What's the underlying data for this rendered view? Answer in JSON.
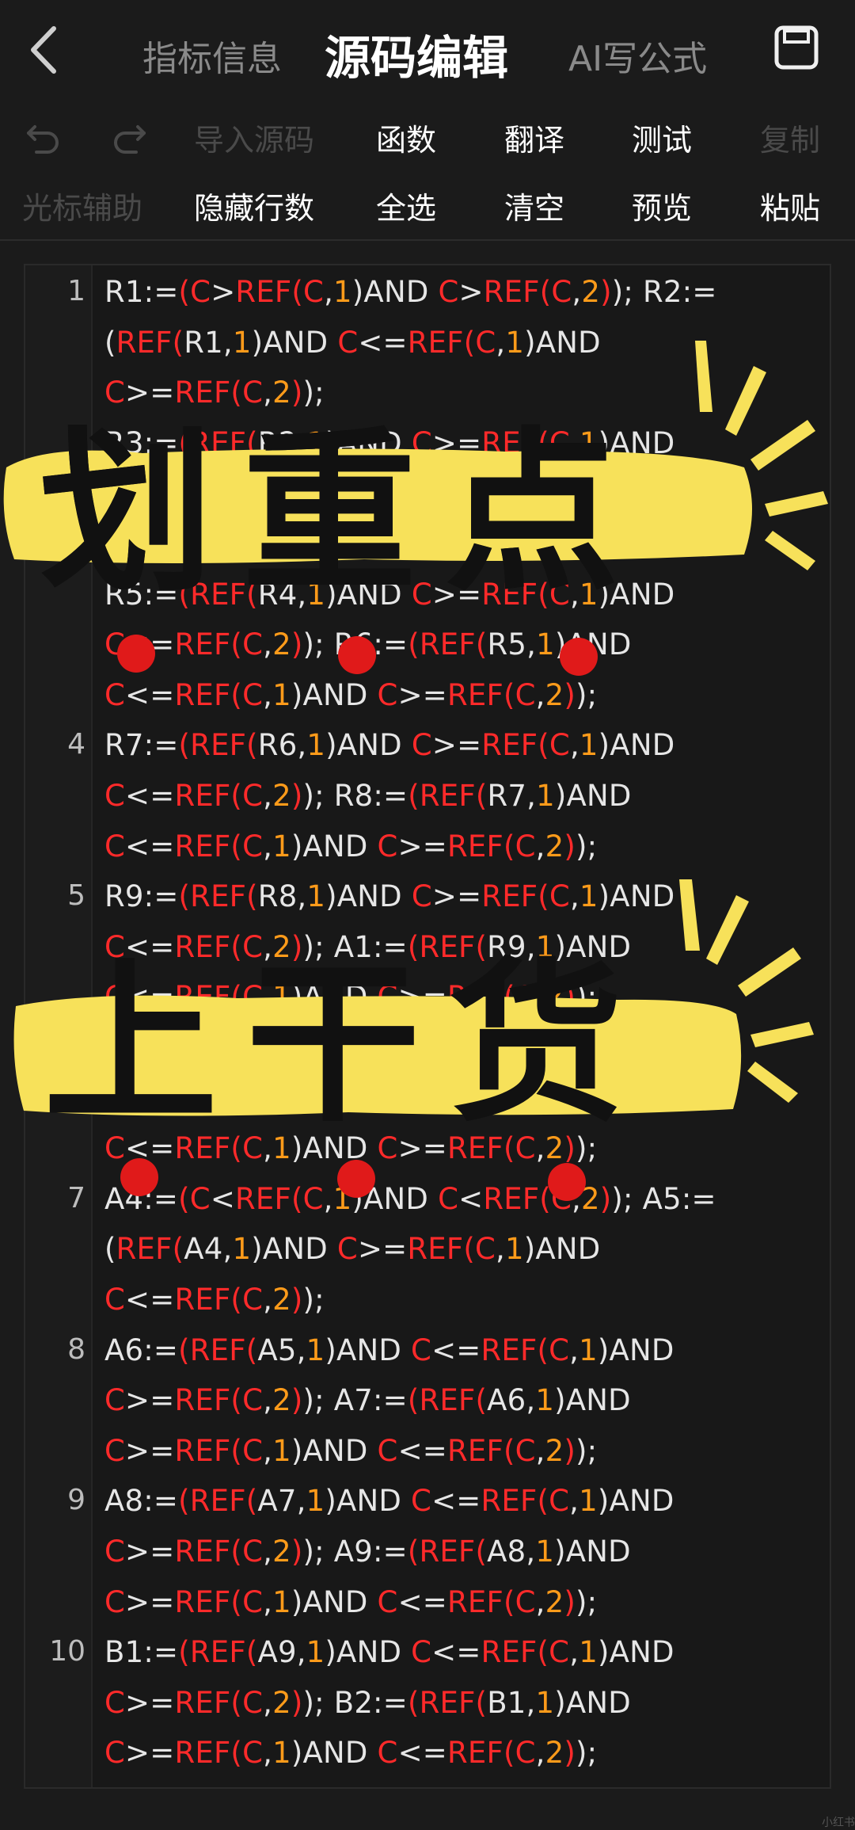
{
  "header": {
    "back_icon": "chevron-left-icon",
    "tabs": [
      {
        "label": "指标信息",
        "active": false
      },
      {
        "label": "源码编辑",
        "active": true
      },
      {
        "label": "AI写公式",
        "active": false
      }
    ],
    "save_icon": "save-icon"
  },
  "toolbar": {
    "row1": [
      {
        "label": "导入源码",
        "enabled": false
      },
      {
        "label": "函数",
        "enabled": true
      },
      {
        "label": "翻译",
        "enabled": true
      },
      {
        "label": "测试",
        "enabled": true
      },
      {
        "label": "复制",
        "enabled": false
      }
    ],
    "row2": [
      {
        "label": "光标辅助",
        "enabled": false
      },
      {
        "label": "隐藏行数",
        "enabled": true
      },
      {
        "label": "全选",
        "enabled": true
      },
      {
        "label": "清空",
        "enabled": true
      },
      {
        "label": "预览",
        "enabled": true
      },
      {
        "label": "粘贴",
        "enabled": true
      }
    ]
  },
  "editor": {
    "line_numbers": [
      "1",
      "",
      "",
      "",
      "",
      "",
      "4",
      "",
      "",
      "5",
      "",
      "",
      "",
      "",
      "",
      "7",
      "",
      "",
      "8",
      "",
      "",
      "9",
      "",
      "",
      "10",
      "",
      ""
    ],
    "visible_line_numbers": [
      {
        "n": "1",
        "row": 0
      },
      {
        "n": "4",
        "row": 9
      },
      {
        "n": "5",
        "row": 12
      },
      {
        "n": "7",
        "row": 18
      },
      {
        "n": "8",
        "row": 21
      },
      {
        "n": "9",
        "row": 24
      },
      {
        "n": "10",
        "row": 27
      }
    ],
    "code_rows": [
      "R1:=(C>REF(C,1)AND C>REF(C,2)); R2:=",
      "(REF(R1,1)AND C<=REF(C,1)AND",
      "C>=REF(C,2));",
      "R3:=(REF(R2,1)AND C>=REF(C,1)AND",
      "",
      "",
      "R5:=(REF(R4,1)AND C>=REF(C,1)AND",
      "C<=REF(C,2)); R6:=(REF(R5,1)AND",
      "C<=REF(C,1)AND C>=REF(C,2));",
      "R7:=(REF(R6,1)AND C>=REF(C,1)AND",
      "C<=REF(C,2)); R8:=(REF(R7,1)AND",
      "C<=REF(C,1)AND C>=REF(C,2));",
      "R9:=(REF(R8,1)AND C>=REF(C,1)AND",
      "C<=REF(C,2)); A1:=(REF(R9,1)AND",
      "C<=REF(C,1)AND C>=REF(C,2));",
      "",
      "",
      "C<=REF(C,1)AND C>=REF(C,2));",
      "A4:=(C<REF(C,1)AND C<REF(C,2)); A5:=",
      "(REF(A4,1)AND C>=REF(C,1)AND",
      "C<=REF(C,2));",
      "A6:=(REF(A5,1)AND C<=REF(C,1)AND",
      "C>=REF(C,2)); A7:=(REF(A6,1)AND",
      "C>=REF(C,1)AND C<=REF(C,2));",
      "A8:=(REF(A7,1)AND C<=REF(C,1)AND",
      "C>=REF(C,2)); A9:=(REF(A8,1)AND",
      "C>=REF(C,1)AND C<=REF(C,2));",
      "B1:=(REF(A9,1)AND C<=REF(C,1)AND",
      "C>=REF(C,2)); B2:=(REF(B1,1)AND",
      "C>=REF(C,1)AND C<=REF(C,2));"
    ]
  },
  "overlay": {
    "banner1_text": "划重点",
    "banner2_text": "上干货",
    "highlight_color": "#f7e15a",
    "dot_color": "#e01a1a"
  },
  "colors": {
    "background": "#1b1b1b",
    "keyword_red": "#ff2a2a",
    "number_orange": "#ff9b1a",
    "text": "#e6e6e6"
  },
  "watermark": "小红书"
}
